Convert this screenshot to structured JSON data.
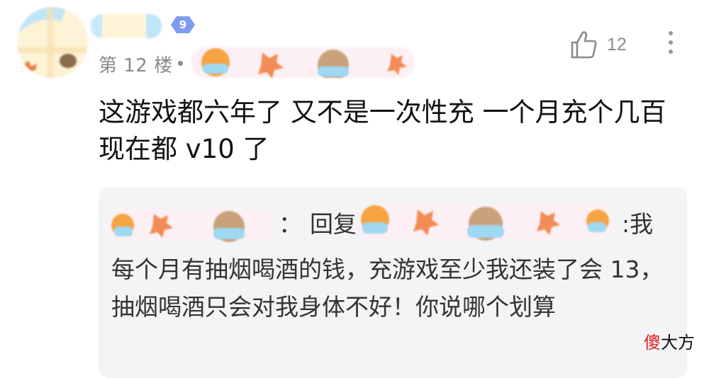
{
  "post": {
    "floor_label": "第 12 楼",
    "level": "9",
    "like_count": "12",
    "content": "这游戏都六年了 又不是一次性充 一个月充个几百 现在都 v10 了"
  },
  "reply": {
    "colon_after_user": "：",
    "prefix": "回复",
    "colon_after_target": ":我",
    "text": "每个月有抽烟喝酒的钱，充游戏至少我还装了会 13，抽烟喝酒只会对我身体不好！你说哪个划算"
  },
  "watermark": {
    "part1": "傻",
    "part2": "大方"
  },
  "colors": {
    "level_badge": "#7e9cf0",
    "meta_text": "#8a8a8a",
    "reply_bg": "#f4f4f6",
    "watermark_red": "#e02020"
  },
  "icons": [
    "thumbs-up-icon",
    "more-vertical-icon",
    "level-badge-icon"
  ]
}
